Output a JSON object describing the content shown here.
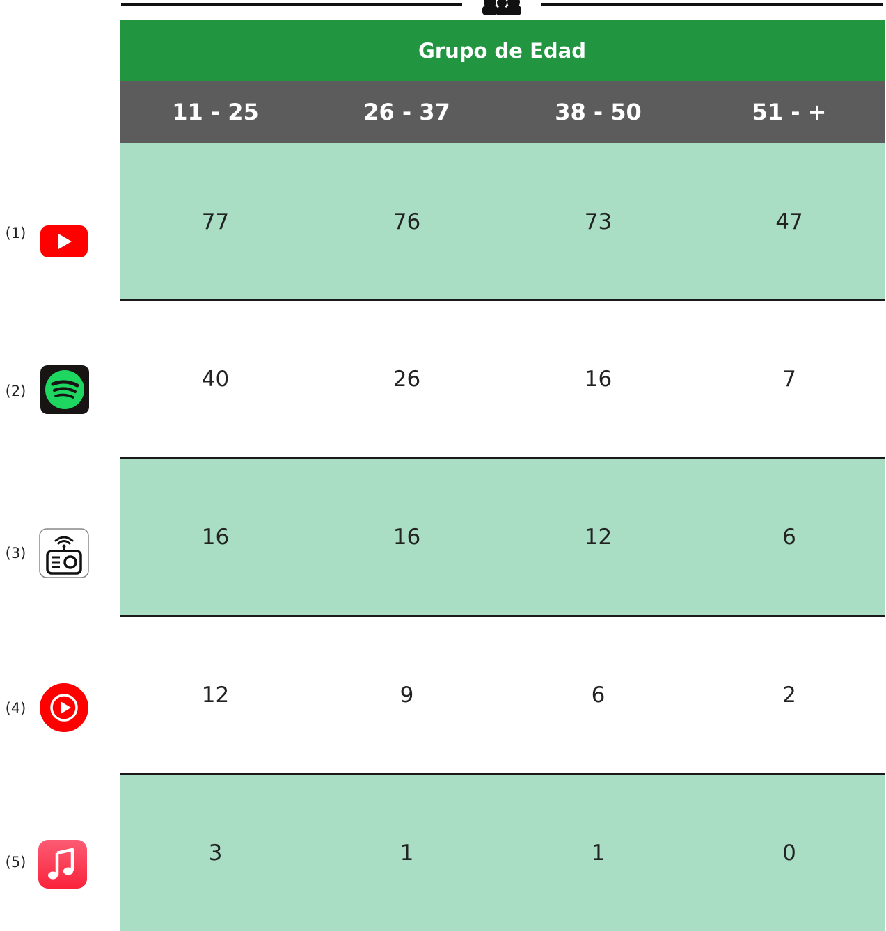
{
  "chart_data": {
    "type": "table",
    "title": "Grupo de Edad",
    "columns": [
      "11 - 25",
      "26 - 37",
      "38 - 50",
      "51 - +"
    ],
    "rows": [
      {
        "label": "(1)",
        "icon": "youtube-icon",
        "values": [
          77,
          76,
          73,
          47
        ]
      },
      {
        "label": "(2)",
        "icon": "spotify-icon",
        "values": [
          40,
          26,
          16,
          7
        ]
      },
      {
        "label": "(3)",
        "icon": "radio-icon",
        "values": [
          16,
          16,
          12,
          6
        ]
      },
      {
        "label": "(4)",
        "icon": "youtube-music-icon",
        "values": [
          12,
          9,
          6,
          2
        ]
      },
      {
        "label": "(5)",
        "icon": "apple-music-icon",
        "values": [
          3,
          1,
          1,
          0
        ]
      }
    ]
  },
  "colors": {
    "header_green": "#21953f",
    "header_gray": "#5c5c5c",
    "row_shade": "#a9ddc4",
    "youtube_red": "#ff0000",
    "spotify_green": "#1ed760",
    "apple_music_pink": "#fa2d48"
  }
}
